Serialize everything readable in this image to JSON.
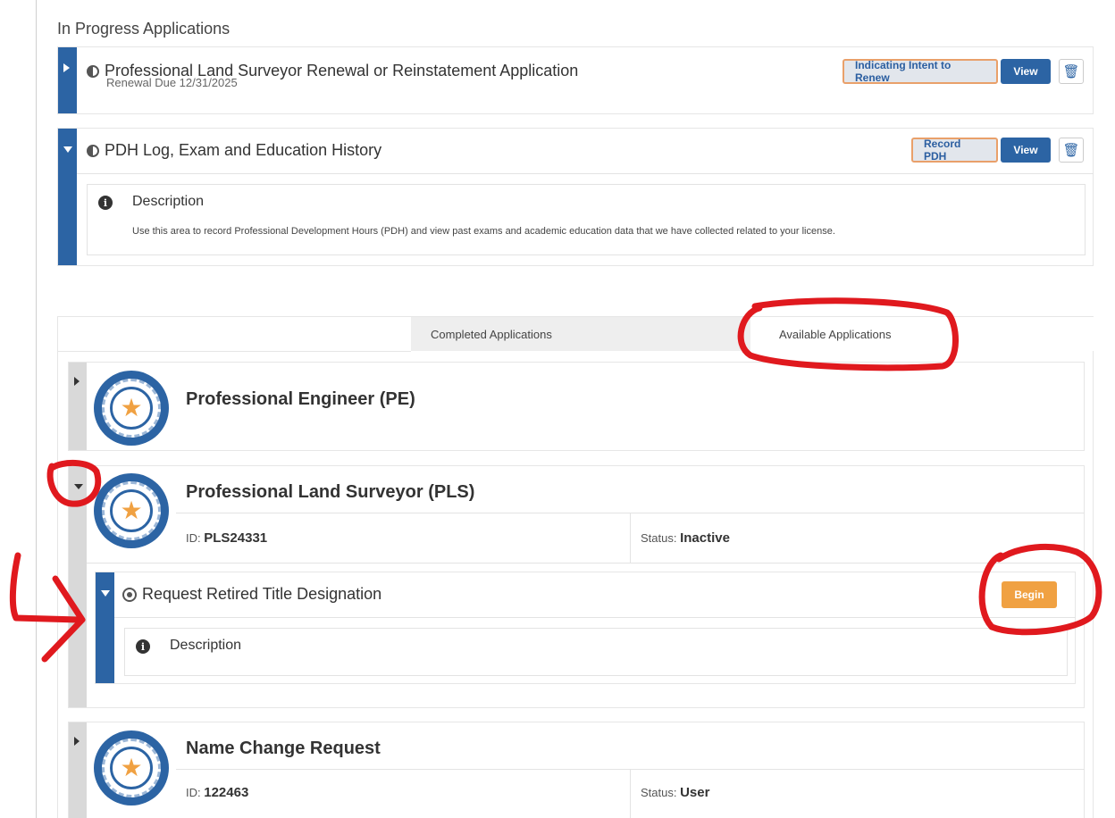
{
  "in_progress": {
    "heading": "In Progress Applications",
    "cards": [
      {
        "title": "Professional Land Surveyor Renewal or Reinstatement Application",
        "subtitle": "Renewal Due 12/31/2025",
        "action_label": "Indicating Intent to Renew",
        "view_label": "View"
      },
      {
        "title": "PDH Log, Exam and Education History",
        "action_label": "Record PDH",
        "view_label": "View",
        "description_label": "Description",
        "description_text": "Use this area to record Professional Development Hours (PDH) and view past exams and academic education data that we have collected related to your license."
      }
    ]
  },
  "tabs": {
    "completed": "Completed Applications",
    "available": "Available Applications"
  },
  "licenses": [
    {
      "title": "Professional Engineer (PE)"
    },
    {
      "title": "Professional Land Surveyor (PLS)",
      "id_label": "ID:",
      "id_value": "PLS24331",
      "status_label": "Status:",
      "status_value": "Inactive",
      "sub_application": {
        "title": "Request Retired Title Designation",
        "begin_label": "Begin",
        "description_label": "Description"
      }
    },
    {
      "title": "Name Change Request",
      "id_label": "ID:",
      "id_value": "122463",
      "status_label": "Status:",
      "status_value": "User"
    }
  ],
  "icons": {
    "expand": "caret-right-icon",
    "collapse": "caret-down-icon",
    "status": "half-circle-icon",
    "trash": "trash-icon",
    "info": "info-icon",
    "badge": "license-badge-icon",
    "target": "target-icon"
  },
  "colors": {
    "primary": "#2c64a4",
    "accent_orange": "#f0a142",
    "outline_orange": "#e9a06a",
    "annotation_red": "#e0191e"
  }
}
